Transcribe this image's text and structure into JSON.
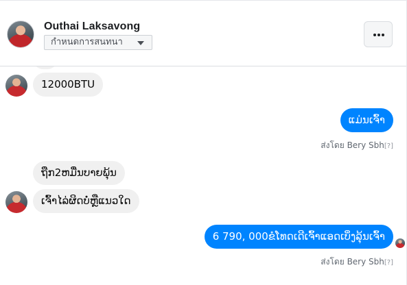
{
  "header": {
    "contact_name": "Outhai Laksavong",
    "assign_label": "กำหนดการสนทนา",
    "more_label": "..."
  },
  "messages": [
    {
      "from": "contact",
      "text": "12000BTU"
    },
    {
      "from": "page",
      "text": "ແມ່ນເຈົ້າ",
      "sent_by": "ส่งโดย Bery Sbh",
      "sent_by_mark": "[?]"
    },
    {
      "from": "contact",
      "text": "ຖືກ2ຫມື່ນບາຍພຸ້ນ"
    },
    {
      "from": "contact",
      "text": "ເຈົ້າໄລ່ຜິດບໍ່ຫຼືແນວໃດ"
    },
    {
      "from": "page",
      "text": "6 790, 000ຂໍໂທດເດີເຈົ້າແອດເບິ່ງລຸ້ນເຈົ້າ",
      "sent_by": "ส่งโดย Bery Sbh",
      "sent_by_mark": "[?]"
    }
  ]
}
